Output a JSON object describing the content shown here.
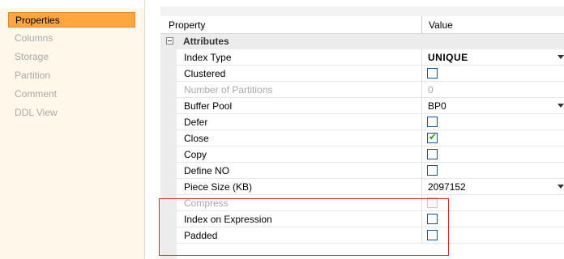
{
  "nav": {
    "items": [
      {
        "label": "Properties",
        "selected": true
      },
      {
        "label": "Columns",
        "selected": false
      },
      {
        "label": "Storage",
        "selected": false
      },
      {
        "label": "Partition",
        "selected": false
      },
      {
        "label": "Comment",
        "selected": false
      },
      {
        "label": "DDL View",
        "selected": false
      }
    ]
  },
  "grid": {
    "header": {
      "property": "Property",
      "value": "Value"
    },
    "category": "Attributes",
    "rows": [
      {
        "name": "Index Type",
        "value": "UNIQUE",
        "kind": "dropdown",
        "disabled": false
      },
      {
        "name": "Clustered",
        "kind": "checkbox",
        "checked": false,
        "disabled": false
      },
      {
        "name": "Number of Partitions",
        "value": "0",
        "kind": "text",
        "disabled": true
      },
      {
        "name": "Buffer Pool",
        "value": "BP0",
        "kind": "dropdown",
        "disabled": false
      },
      {
        "name": "Defer",
        "kind": "checkbox",
        "checked": false,
        "disabled": false
      },
      {
        "name": "Close",
        "kind": "checkbox",
        "checked": true,
        "disabled": false
      },
      {
        "name": "Copy",
        "kind": "checkbox",
        "checked": false,
        "disabled": false
      },
      {
        "name": "Define NO",
        "kind": "checkbox",
        "checked": false,
        "disabled": false
      },
      {
        "name": "Piece Size (KB)",
        "value": "2097152",
        "kind": "dropdown",
        "disabled": false
      },
      {
        "name": "Compress",
        "kind": "checkbox",
        "checked": false,
        "disabled": true
      },
      {
        "name": "Index on Expression",
        "kind": "checkbox",
        "checked": false,
        "disabled": false
      },
      {
        "name": "Padded",
        "kind": "checkbox",
        "checked": false,
        "disabled": false
      }
    ]
  },
  "colors": {
    "selected_nav": "#ffa63f",
    "highlight_border": "#e01f1f",
    "check_mark": "#21a121"
  }
}
